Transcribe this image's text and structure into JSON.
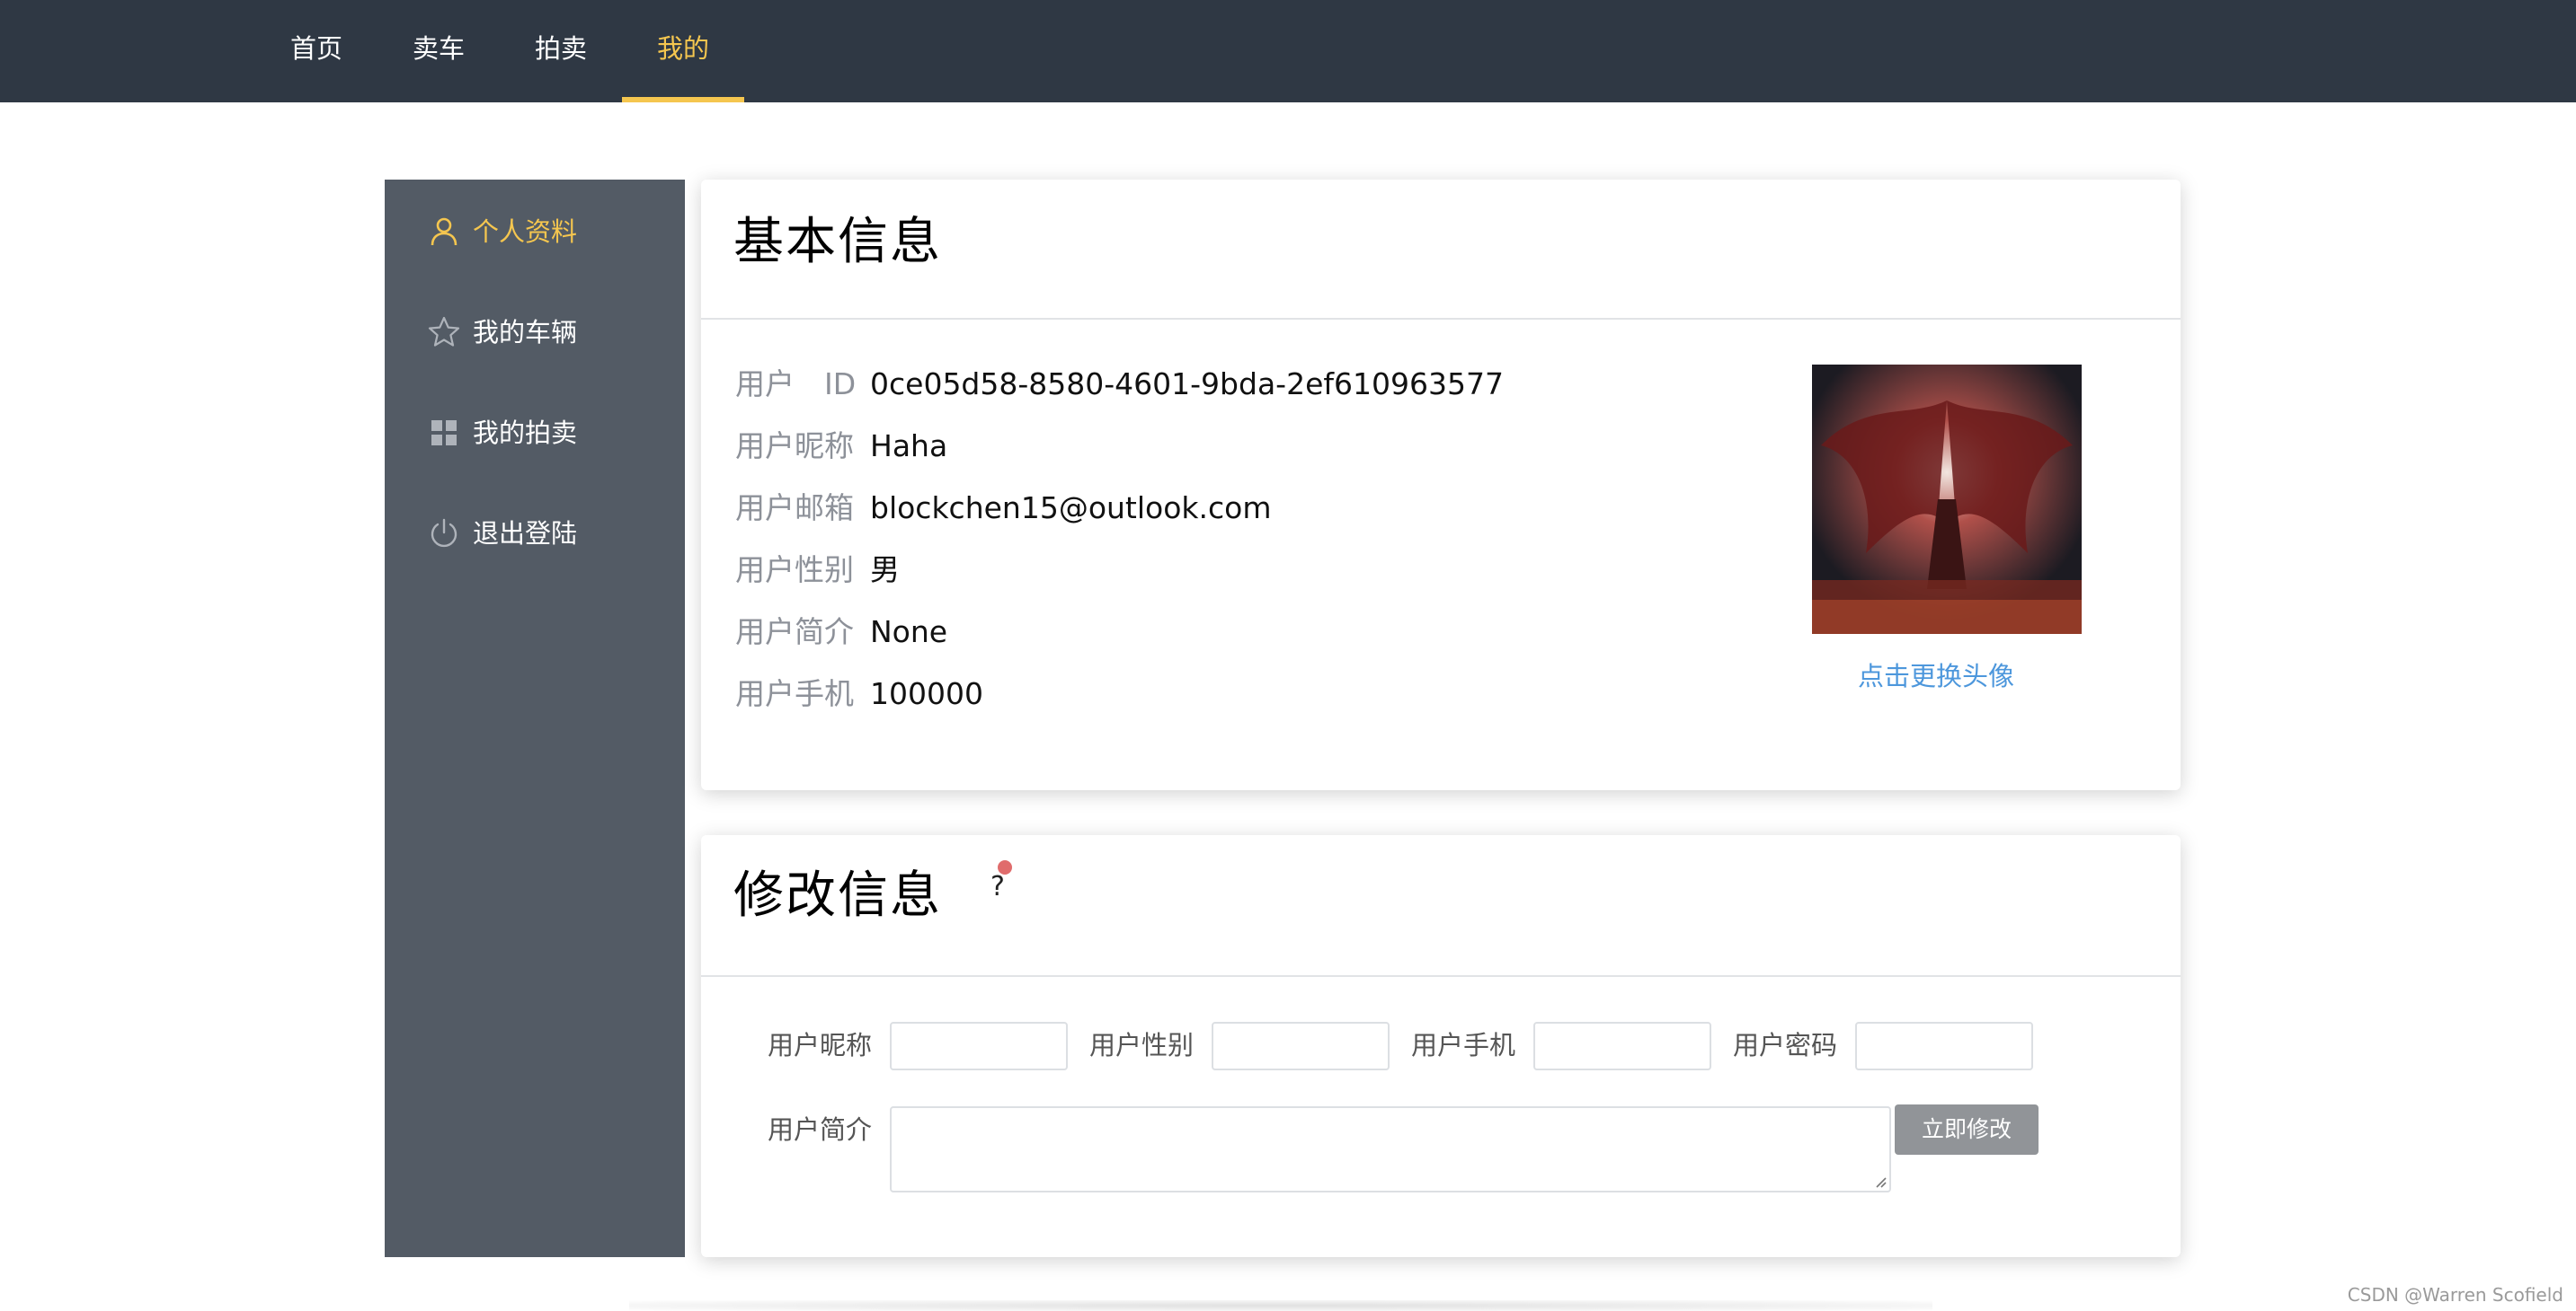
{
  "nav": {
    "items": [
      {
        "label": "首页"
      },
      {
        "label": "卖车"
      },
      {
        "label": "拍卖"
      },
      {
        "label": "我的"
      }
    ],
    "active_color": "#f5c64f",
    "bg_color": "#2f3844"
  },
  "sidebar": {
    "items": [
      {
        "label": "个人资料",
        "icon": "user-icon"
      },
      {
        "label": "我的车辆",
        "icon": "star-icon"
      },
      {
        "label": "我的拍卖",
        "icon": "grid-icon"
      },
      {
        "label": "退出登陆",
        "icon": "power-icon"
      }
    ],
    "bg_color": "#535b65"
  },
  "basic_info": {
    "title": "基本信息",
    "rows": [
      {
        "label": "用户　ID",
        "value": "0ce05d58-8580-4601-9bda-2ef610963577"
      },
      {
        "label": "用户昵称",
        "value": "Haha"
      },
      {
        "label": "用户邮箱",
        "value": "blockchen15@outlook.com"
      },
      {
        "label": "用户性别",
        "value": "男"
      },
      {
        "label": "用户简介",
        "value": "None"
      },
      {
        "label": "用户手机",
        "value": "100000"
      }
    ],
    "avatar_link": "点击更换头像",
    "link_color": "#4d97dc"
  },
  "edit_info": {
    "title": "修改信息",
    "help": "?",
    "fields": {
      "nickname": {
        "label": "用户昵称",
        "value": ""
      },
      "gender": {
        "label": "用户性别",
        "value": ""
      },
      "phone": {
        "label": "用户手机",
        "value": ""
      },
      "password": {
        "label": "用户密码",
        "value": ""
      },
      "bio": {
        "label": "用户简介",
        "value": ""
      }
    },
    "submit_label": "立即修改"
  },
  "watermark": "CSDN @Warren Scofield"
}
